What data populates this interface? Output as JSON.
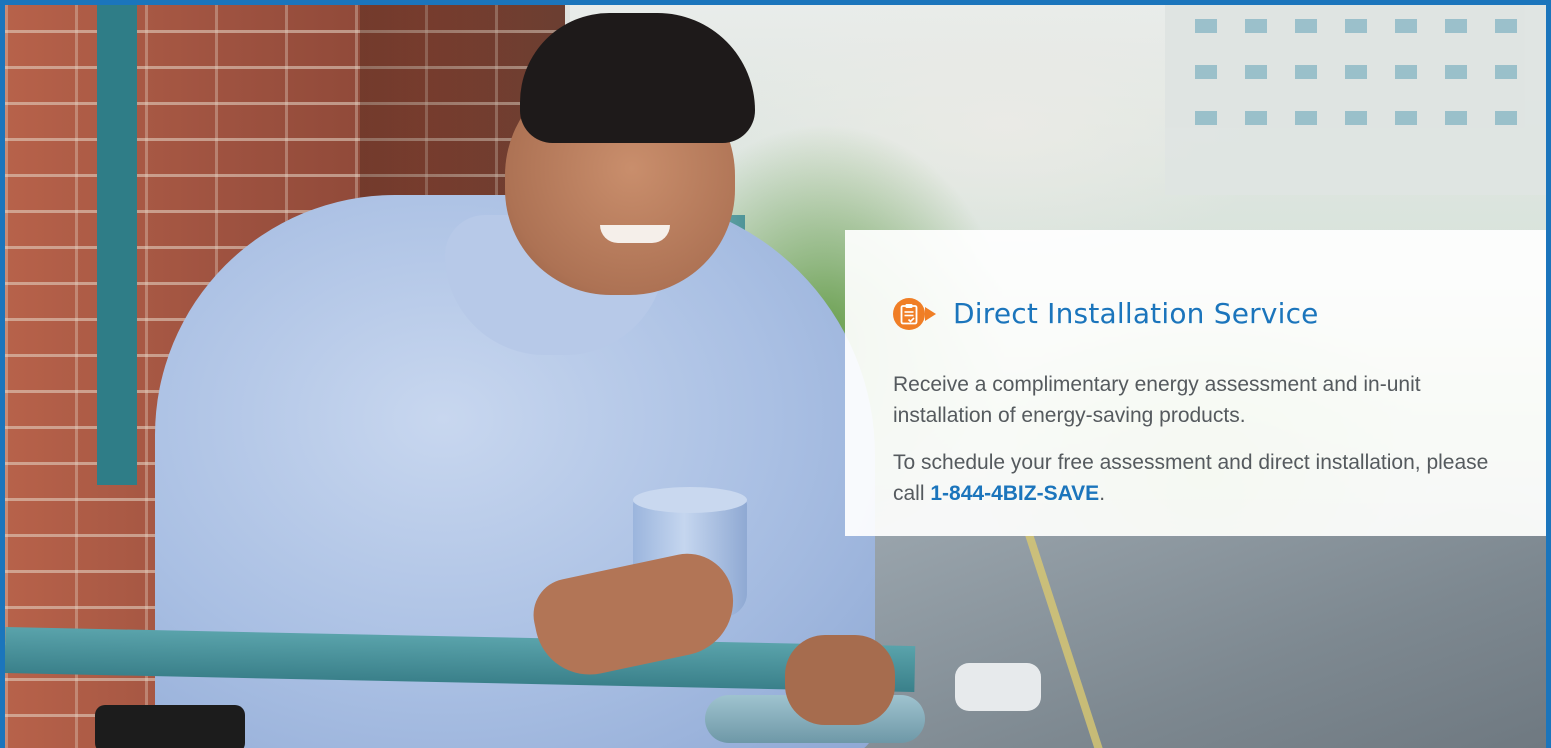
{
  "card": {
    "title": "Direct Installation Service",
    "icon": "clipboard-checklist-icon",
    "paragraph_1": "Receive a complimentary energy assessment and in-unit installation of energy-saving products.",
    "paragraph_2_prefix": "To schedule your free assessment and direct installation, please call",
    "phone": "1-844-4BIZ-SAVE",
    "paragraph_2_suffix": "."
  },
  "colors": {
    "accent_blue": "#1b75bc",
    "icon_orange": "#f07e26",
    "body_text": "#555a5e"
  }
}
